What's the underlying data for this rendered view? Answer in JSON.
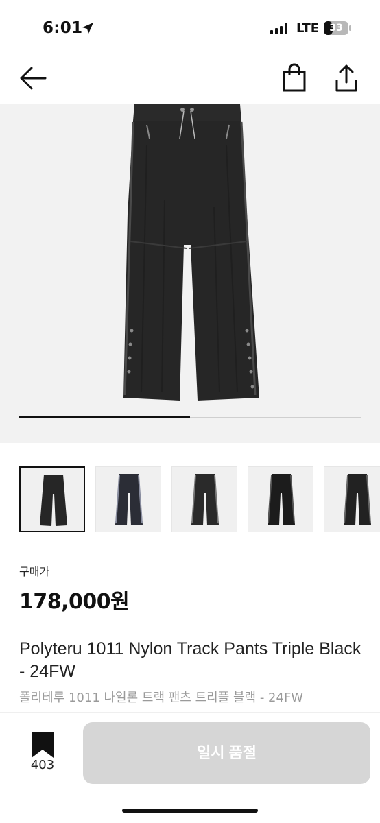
{
  "status_bar": {
    "time": "6:01",
    "network": "LTE",
    "battery": "33"
  },
  "nav": {
    "back_icon": "arrow-left-icon",
    "bag_icon": "shopping-bag-icon",
    "share_icon": "share-icon"
  },
  "gallery": {
    "progress": 0.5,
    "thumbnail_count": 5,
    "selected_index": 0
  },
  "product": {
    "price_label": "구매가",
    "price": "178,000원",
    "title_en": "Polyteru 1011 Nylon Track Pants Triple Black - 24FW",
    "title_ko": "폴리테루 1011 나일론 트랙 팬츠 트리플 블랙 - 24FW"
  },
  "bottom": {
    "bookmark_count": "403",
    "buy_button_label": "일시 품절"
  },
  "colors": {
    "accent": "#111111",
    "disabled_button": "#d6d6d6",
    "muted_text": "#9a9a9a"
  }
}
